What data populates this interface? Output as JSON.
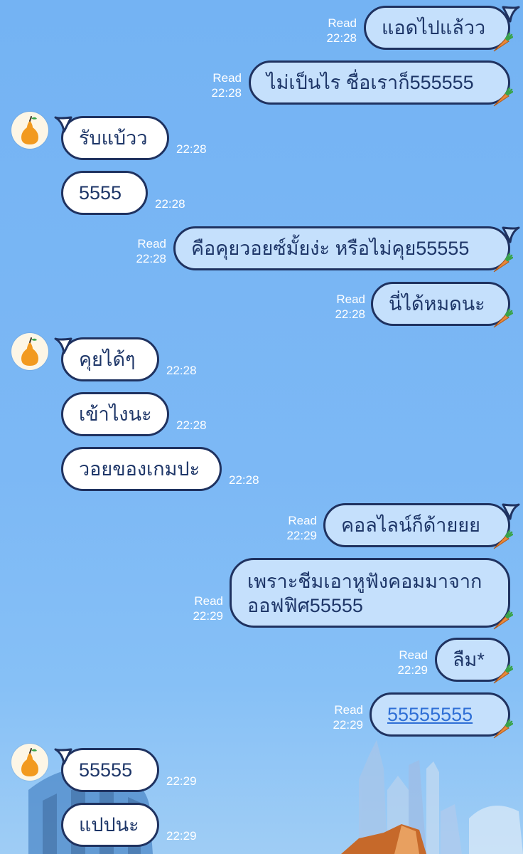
{
  "colors": {
    "background": "#7cb8f5",
    "outgoing_bubble": "#c5e0fc",
    "incoming_bubble": "#ffffff",
    "bubble_border": "#1f3260",
    "text": "#1e3668",
    "link": "#2f6fd6",
    "meta_text": "#ffffff"
  },
  "contact": {
    "avatar_icon": "pear-icon"
  },
  "messages": [
    {
      "dir": "out",
      "text": "แอดไปแล้วว",
      "read": "Read",
      "time": "22:28"
    },
    {
      "dir": "out",
      "text": "ไม่เป็นไร ชื่อเราก็555555",
      "read": "Read",
      "time": "22:28"
    },
    {
      "dir": "in",
      "text": "รับแบ้วว",
      "time": "22:28"
    },
    {
      "dir": "in",
      "text": "5555",
      "time": "22:28"
    },
    {
      "dir": "out",
      "text": "คือคุยวอยซ์มั้ยง่ะ หรือไม่คุย55555",
      "read": "Read",
      "time": "22:28"
    },
    {
      "dir": "out",
      "text": "นี่ได้หมดนะ",
      "read": "Read",
      "time": "22:28"
    },
    {
      "dir": "in",
      "text": "คุยได้ๆ",
      "time": "22:28"
    },
    {
      "dir": "in",
      "text": "เข้าไงนะ",
      "time": "22:28"
    },
    {
      "dir": "in",
      "text": "วอยของเกมปะ",
      "time": "22:28"
    },
    {
      "dir": "out",
      "text": "คอลไลน์ก็ด้ายยย",
      "read": "Read",
      "time": "22:29"
    },
    {
      "dir": "out",
      "text": "เพราะชีมเอาหูฟังคอมมาจากออฟฟิศ55555",
      "line1": "เพราะชีมเอาหูฟังคอมมาจาก",
      "line2": "ออฟฟิศ55555",
      "read": "Read",
      "time": "22:29"
    },
    {
      "dir": "out",
      "text": "ลืม*",
      "read": "Read",
      "time": "22:29"
    },
    {
      "dir": "out",
      "text": "55555555",
      "is_link": true,
      "read": "Read",
      "time": "22:29"
    },
    {
      "dir": "in",
      "text": "55555",
      "time": "22:29"
    },
    {
      "dir": "in",
      "text": "แปปนะ",
      "time": "22:29"
    }
  ]
}
